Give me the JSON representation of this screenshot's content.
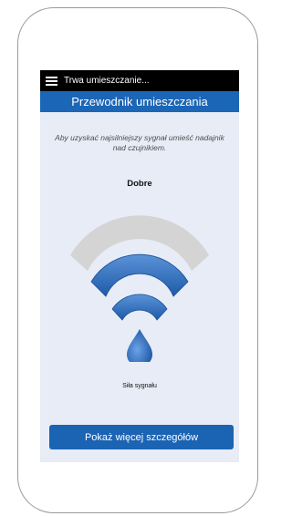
{
  "status_bar": {
    "text": "Trwa umieszczanie..."
  },
  "header": {
    "title": "Przewodnik umieszczania"
  },
  "instructions": "Aby uzyskać najsilniejszy sygnał umieść nadajnik nad czujnikiem.",
  "signal": {
    "quality_label": "Dobre",
    "strength_label": "Siła sygnału",
    "bars_active": 2,
    "bars_total": 3,
    "colors": {
      "active": "#2f6fc0",
      "inactive": "#d4d4d4",
      "drop": "#2a66b4"
    }
  },
  "details_button": {
    "label": "Pokaż więcej szczegółów"
  },
  "colors": {
    "header": "#1b66b6",
    "screen_bg": "#e7ecf6",
    "status_bg": "#000000"
  }
}
